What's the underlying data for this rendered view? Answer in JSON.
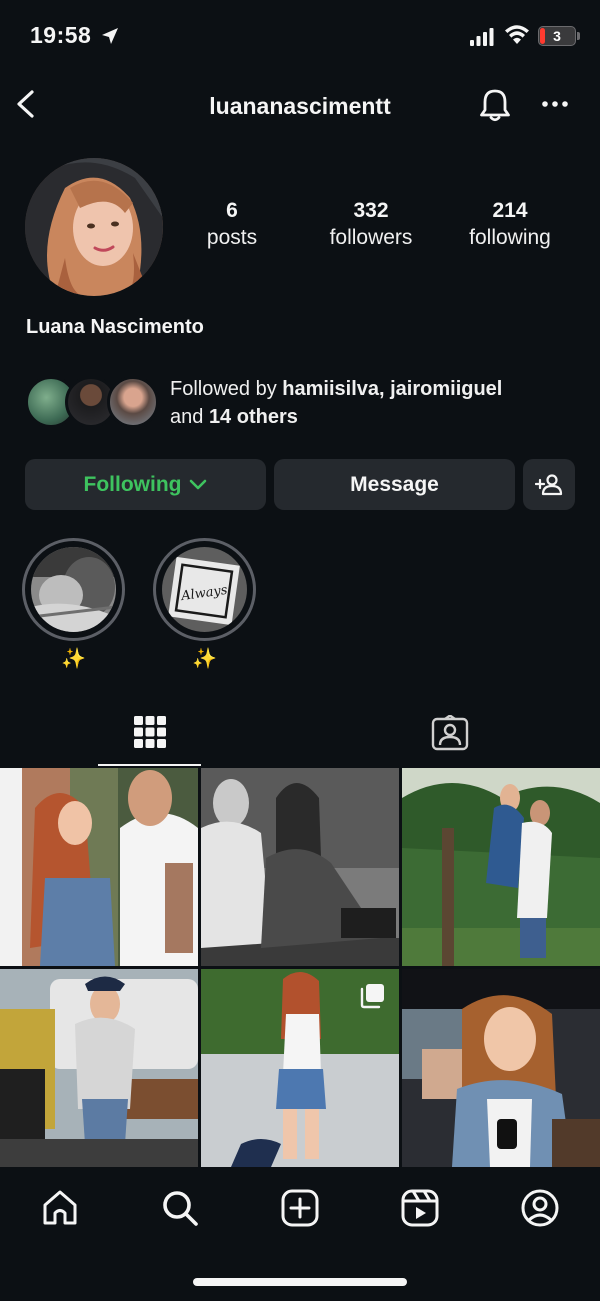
{
  "status_bar": {
    "time": "19:58",
    "battery": "3"
  },
  "header": {
    "username": "luananascimentt"
  },
  "profile": {
    "full_name": "Luana Nascimento",
    "stats": [
      {
        "value": "6",
        "label": "posts"
      },
      {
        "value": "332",
        "label": "followers"
      },
      {
        "value": "214",
        "label": "following"
      }
    ],
    "followed_by": {
      "prefix": "Followed by ",
      "names": "hamiisilva, jairomiiguel",
      "middle": "and ",
      "others": "14 others"
    }
  },
  "actions": {
    "following_label": "Following",
    "message_label": "Message"
  },
  "highlights": [
    {
      "label": "✨"
    },
    {
      "label": "✨"
    }
  ],
  "highlight_text": "Always",
  "colors": {
    "background": "#0c1014",
    "button": "#25292e",
    "following_green": "#3ec35f",
    "battery_low": "#ff3b30"
  },
  "icons": {
    "status": [
      "location-arrow-icon",
      "signal-icon",
      "wifi-icon",
      "battery-icon"
    ],
    "header": [
      "back-icon",
      "bell-icon",
      "more-icon"
    ],
    "tabs": [
      "grid-icon",
      "tagged-icon"
    ],
    "nav": [
      "home-icon",
      "search-icon",
      "create-icon",
      "reels-icon",
      "profile-icon"
    ]
  }
}
